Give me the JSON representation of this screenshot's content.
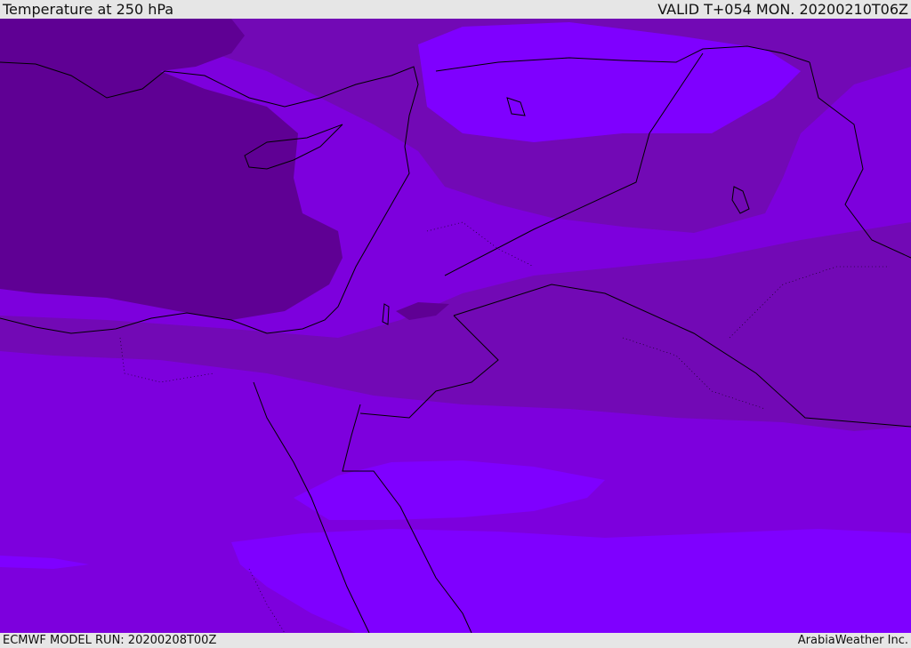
{
  "header": {
    "title": "Temperature at 250 hPa",
    "valid_time": "VALID T+054 MON. 20200210T06Z"
  },
  "footer": {
    "model_run": "ECMWF MODEL RUN: 20200208T00Z",
    "credit": "ArabiaWeather Inc."
  },
  "colors": {
    "background": "#e6e6e6",
    "band_coldest": "#5f0094",
    "band_cold": "#7209b5",
    "band_mid": "#7d00dd",
    "band_warm": "#7f00ff",
    "coastline": "#000000"
  }
}
